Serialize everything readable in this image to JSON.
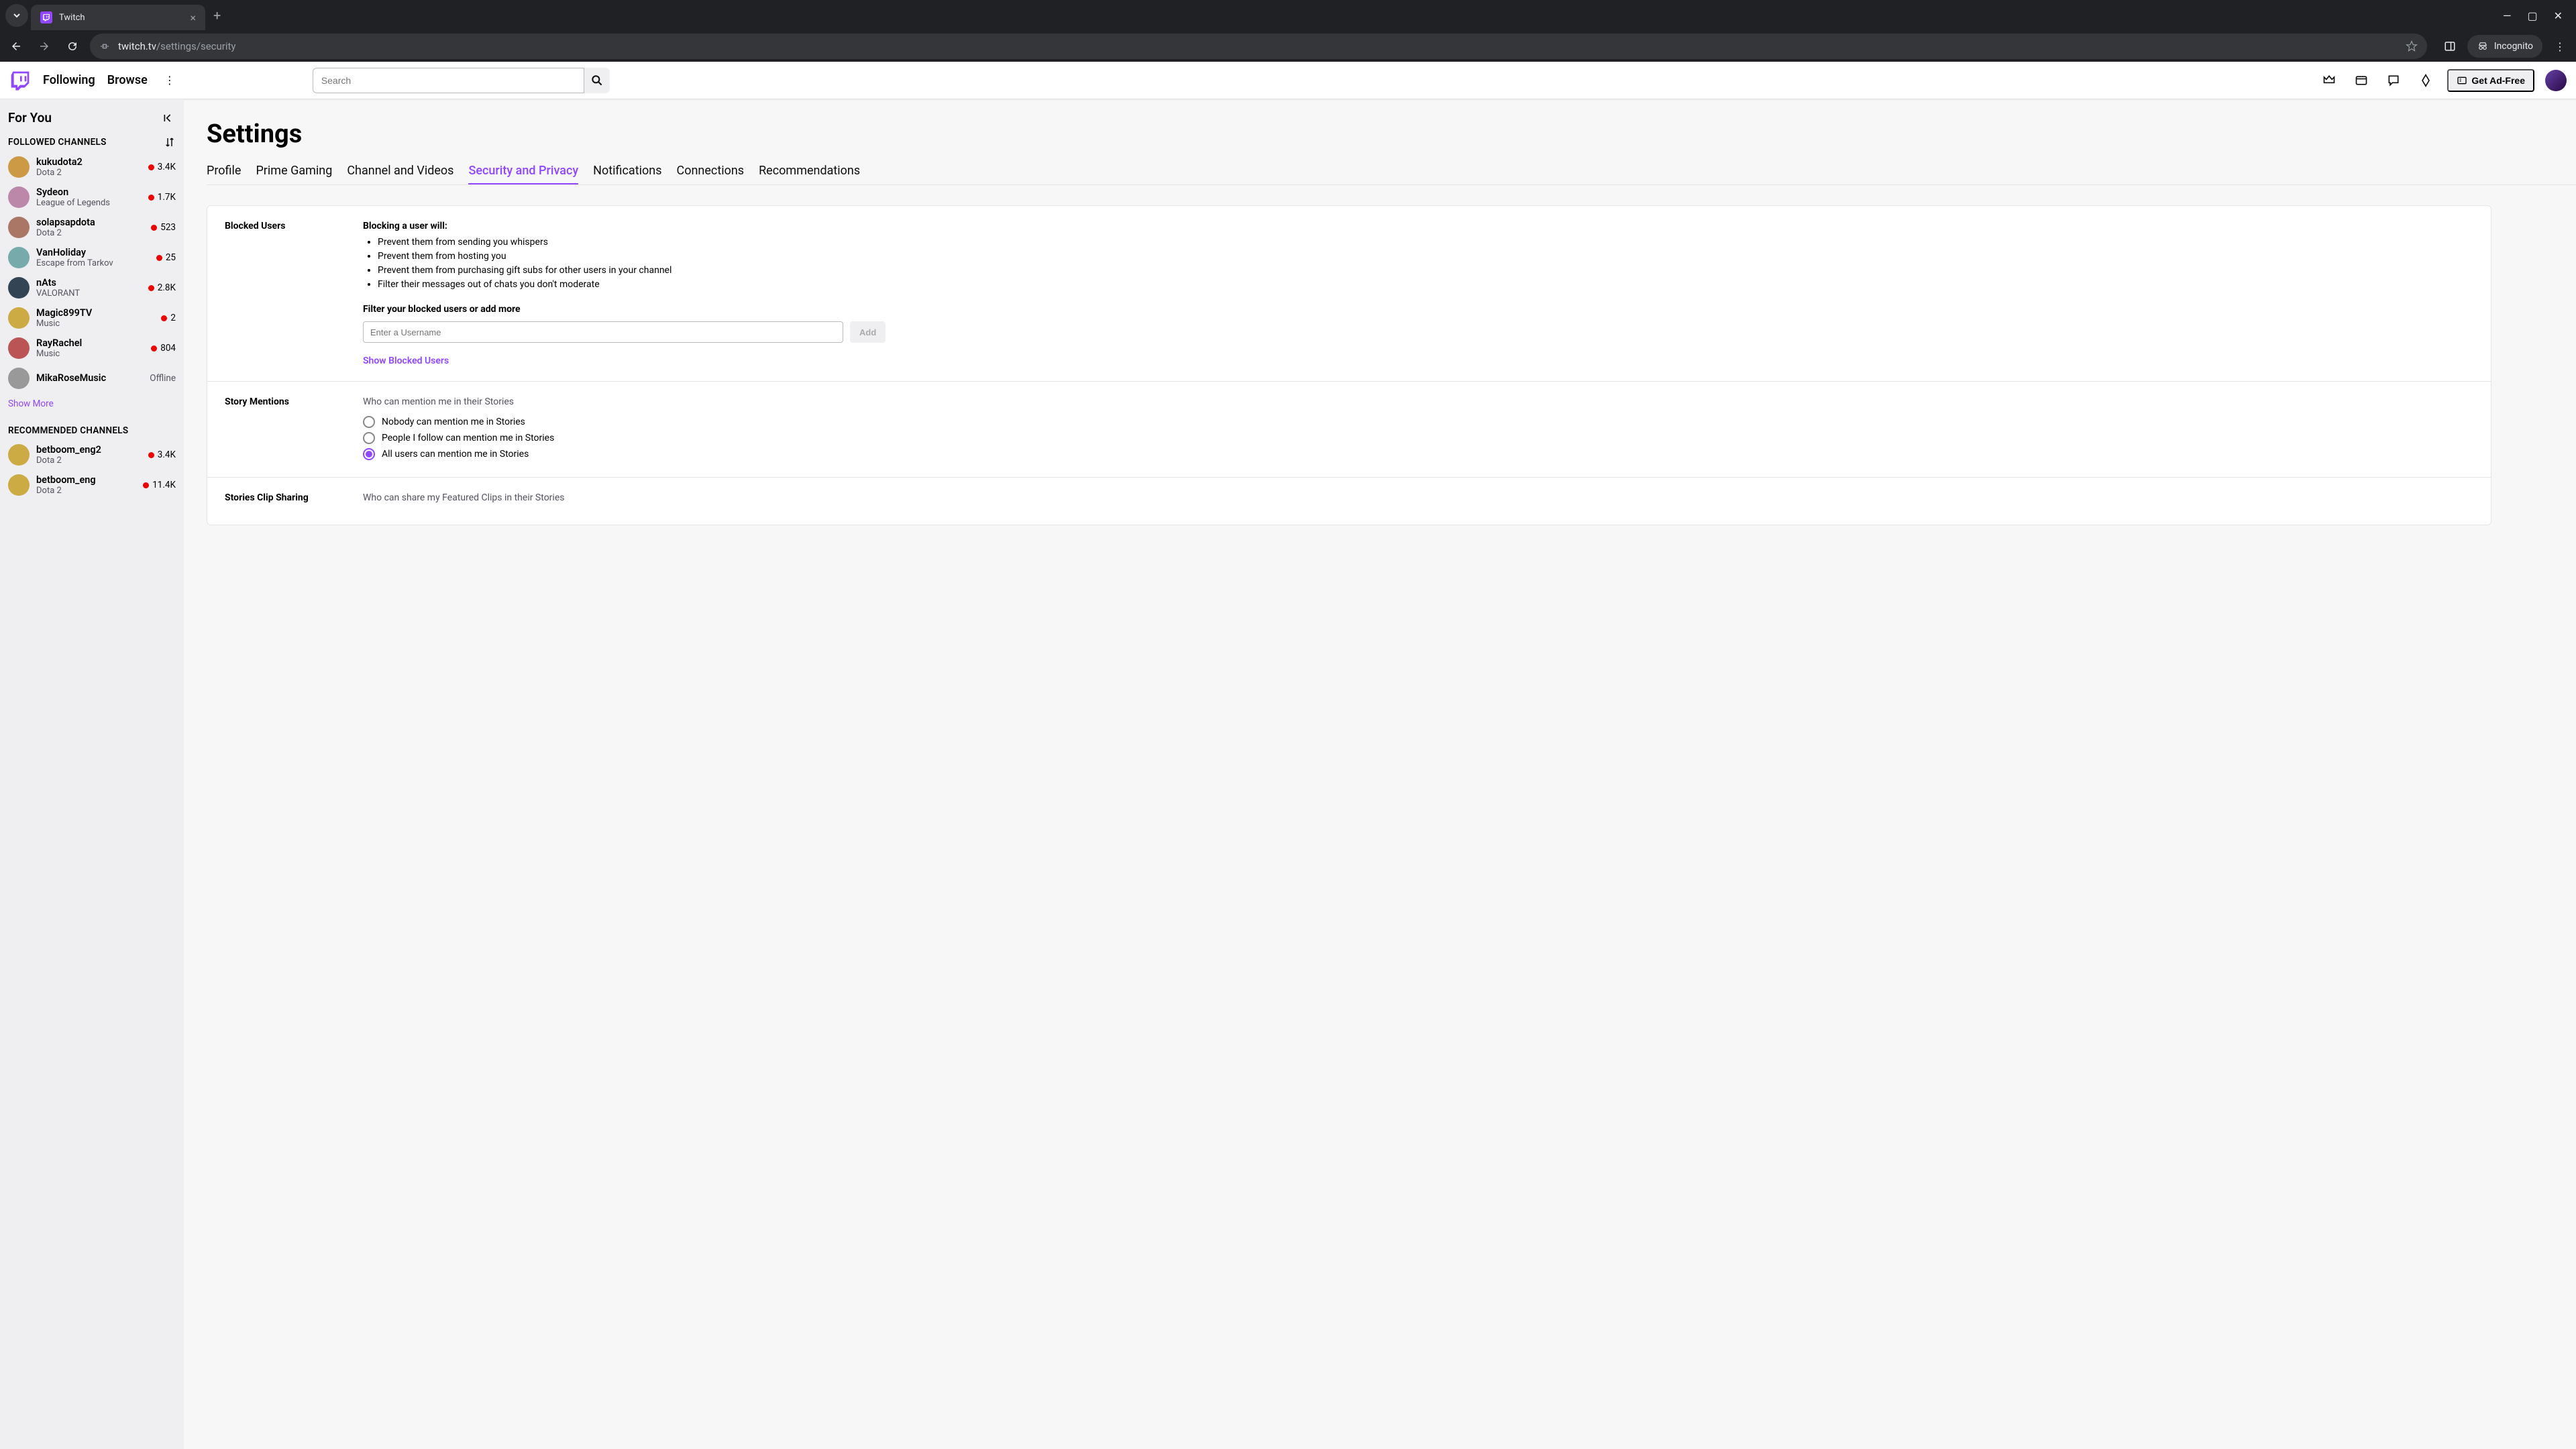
{
  "browser": {
    "tab_title": "Twitch",
    "url_domain": "twitch.tv",
    "url_path": "/settings/security",
    "incognito_label": "Incognito"
  },
  "topnav": {
    "following": "Following",
    "browse": "Browse",
    "search_placeholder": "Search",
    "adfree": "Get Ad-Free"
  },
  "sidebar": {
    "for_you": "For You",
    "followed_heading": "FOLLOWED CHANNELS",
    "followed": [
      {
        "name": "kukudota2",
        "game": "Dota 2",
        "viewers": "3.4K",
        "live": true
      },
      {
        "name": "Sydeon",
        "game": "League of Legends",
        "viewers": "1.7K",
        "live": true
      },
      {
        "name": "solapsapdota",
        "game": "Dota 2",
        "viewers": "523",
        "live": true
      },
      {
        "name": "VanHoliday",
        "game": "Escape from Tarkov",
        "viewers": "25",
        "live": true
      },
      {
        "name": "nAts",
        "game": "VALORANT",
        "viewers": "2.8K",
        "live": true
      },
      {
        "name": "Magic899TV",
        "game": "Music",
        "viewers": "2",
        "live": true
      },
      {
        "name": "RayRachel",
        "game": "Music",
        "viewers": "804",
        "live": true
      },
      {
        "name": "MikaRoseMusic",
        "game": "",
        "viewers": "Offline",
        "live": false
      }
    ],
    "show_more": "Show More",
    "recommended_heading": "RECOMMENDED CHANNELS",
    "recommended": [
      {
        "name": "betboom_eng2",
        "game": "Dota 2",
        "viewers": "3.4K",
        "live": true
      },
      {
        "name": "betboom_eng",
        "game": "Dota 2",
        "viewers": "11.4K",
        "live": true
      }
    ]
  },
  "settings": {
    "title": "Settings",
    "tabs": [
      "Profile",
      "Prime Gaming",
      "Channel and Videos",
      "Security and Privacy",
      "Notifications",
      "Connections",
      "Recommendations"
    ],
    "active_tab_index": 3,
    "blocked": {
      "label": "Blocked Users",
      "intro": "Blocking a user will:",
      "bullets": [
        "Prevent them from sending you whispers",
        "Prevent them from hosting you",
        "Prevent them from purchasing gift subs for other users in your channel",
        "Filter their messages out of chats you don't moderate"
      ],
      "filter_label": "Filter your blocked users or add more",
      "input_placeholder": "Enter a Username",
      "add_btn": "Add",
      "show_link": "Show Blocked Users"
    },
    "story_mentions": {
      "label": "Story Mentions",
      "desc": "Who can mention me in their Stories",
      "options": [
        "Nobody can mention me in Stories",
        "People I follow can mention me in Stories",
        "All users can mention me in Stories"
      ],
      "selected_index": 2
    },
    "clip_sharing": {
      "label": "Stories Clip Sharing",
      "desc": "Who can share my Featured Clips in their Stories"
    }
  }
}
